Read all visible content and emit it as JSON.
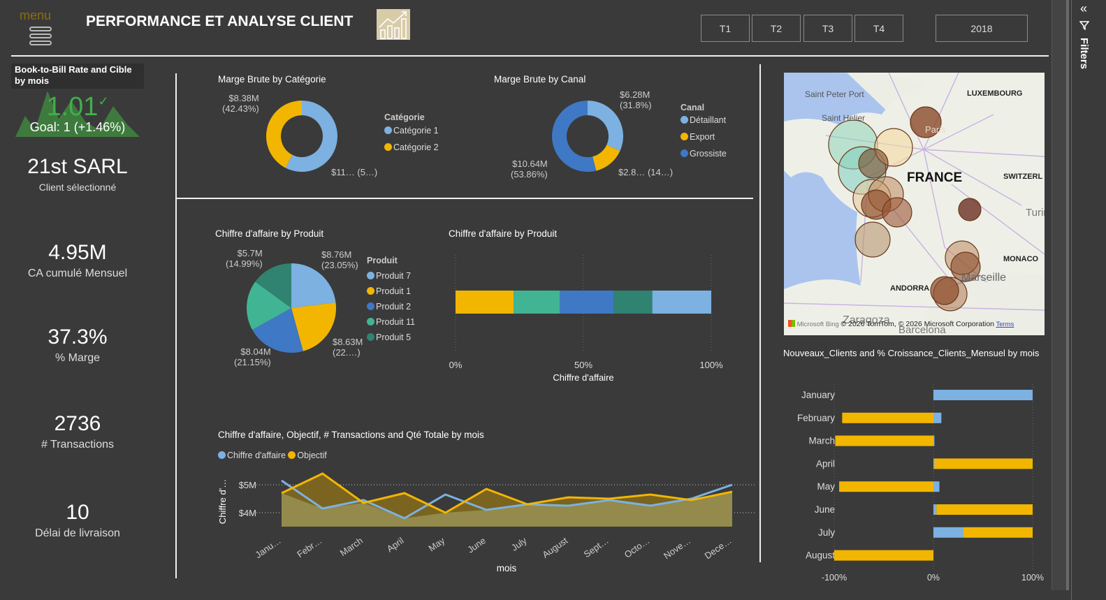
{
  "header": {
    "menu_label": "menu",
    "title": "PERFORMANCE ET ANALYSE CLIENT",
    "quarters": [
      "T1",
      "T2",
      "T3",
      "T4"
    ],
    "year": "2018"
  },
  "filters_pane": {
    "label": "Filters"
  },
  "kpis": {
    "book_to_bill": {
      "title": "Book-to-Bill Rate and Cible by mois",
      "value": "1.01",
      "goal": "Goal: 1 (+1.46%)",
      "color": "#3fb04a"
    },
    "client": {
      "value": "21st SARL",
      "label": "Client sélectionné"
    },
    "ca": {
      "value": "4.95M",
      "label": "CA cumulé Mensuel"
    },
    "marge": {
      "value": "37.3%",
      "label": "% Marge"
    },
    "transactions": {
      "value": "2736",
      "label": "# Transactions"
    },
    "delai": {
      "value": "10",
      "label": "Délai de livraison"
    }
  },
  "colors": {
    "light_blue": "#7cb1e2",
    "yellow": "#f2b600",
    "blue": "#3f78c4",
    "teal": "#41b493",
    "dark_teal": "#2f8370",
    "area": "#938a4c"
  },
  "donut_categorie": {
    "title": "Marge Brute by Catégorie",
    "legend_title": "Catégorie",
    "slices": [
      {
        "name": "Catégorie 1",
        "pct": 57.57,
        "label1": "$11…",
        "label2": "(5…)",
        "color": "#7cb1e2"
      },
      {
        "name": "Catégorie 2",
        "pct": 42.43,
        "label1": "$8.38M",
        "label2": "(42.43%)",
        "color": "#f2b600"
      }
    ]
  },
  "donut_canal": {
    "title": "Marge Brute by Canal",
    "legend_title": "Canal",
    "slices": [
      {
        "name": "Détaillant",
        "pct": 31.8,
        "label1": "$6.28M",
        "label2": "(31.8%)",
        "color": "#7cb1e2"
      },
      {
        "name": "Export",
        "pct": 14.34,
        "label1": "$2.8…",
        "label2": "(14…)",
        "color": "#f2b600"
      },
      {
        "name": "Grossiste",
        "pct": 53.86,
        "label1": "$10.64M",
        "label2": "(53.86%)",
        "color": "#3f78c4"
      }
    ]
  },
  "chart_data": [
    {
      "type": "pie",
      "title": "Chiffre d'affaire by Produit",
      "legend_title": "Produit",
      "slices": [
        {
          "name": "Produit 7",
          "value": 8.76,
          "pct": 23.05,
          "label1": "$8.76M",
          "label2": "(23.05%)",
          "color": "#7cb1e2"
        },
        {
          "name": "Produit 1",
          "value": 8.63,
          "pct": 22.7,
          "label1": "$8.63M",
          "label2": "(22.…)",
          "color": "#f2b600"
        },
        {
          "name": "Produit 2",
          "value": 8.04,
          "pct": 21.15,
          "label1": "$8.04M",
          "label2": "(21.15%)",
          "color": "#3f78c4"
        },
        {
          "name": "Produit 11",
          "value": 6.88,
          "pct": 18.11,
          "label1": "",
          "label2": "",
          "color": "#41b493"
        },
        {
          "name": "Produit 5",
          "value": 5.7,
          "pct": 14.99,
          "label1": "$5.7M",
          "label2": "(14.99%)",
          "color": "#2f8370"
        }
      ]
    },
    {
      "type": "bar",
      "stacked_100": true,
      "title": "Chiffre d'affaire by Produit",
      "xlabel": "Chiffre d'affaire",
      "xticks": [
        "0%",
        "50%",
        "100%"
      ],
      "segments": [
        {
          "name": "Produit 1",
          "pct": 22.7,
          "color": "#f2b600"
        },
        {
          "name": "Produit 11",
          "pct": 18.11,
          "color": "#41b493"
        },
        {
          "name": "Produit 2",
          "pct": 21.15,
          "color": "#3f78c4"
        },
        {
          "name": "Produit 5",
          "pct": 14.99,
          "color": "#2f8370"
        },
        {
          "name": "Produit 7",
          "pct": 23.05,
          "color": "#7cb1e2"
        }
      ]
    },
    {
      "type": "line",
      "title": "Chiffre d'affaire, Objectif, # Transactions and Qté Totale by mois",
      "xlabel": "mois",
      "ylabel": "Chiffre d'…",
      "categories": [
        "Janu…",
        "Febr…",
        "March",
        "April",
        "May",
        "June",
        "July",
        "August",
        "Sept…",
        "Octo…",
        "Nove…",
        "Dece…"
      ],
      "yticks": [
        {
          "v": 4,
          "label": "$4M"
        },
        {
          "v": 5,
          "label": "$5M"
        }
      ],
      "ylim": [
        3.5,
        5.6
      ],
      "grid": true,
      "series": [
        {
          "name": "Chiffre d'affaire",
          "color": "#7cb1e2",
          "values": [
            5.15,
            4.15,
            4.45,
            3.8,
            4.65,
            4.1,
            4.3,
            4.25,
            4.45,
            4.25,
            4.5,
            5.0
          ]
        },
        {
          "name": "Objectif",
          "color": "#f2b600",
          "values": [
            4.7,
            5.4,
            4.35,
            4.7,
            4.0,
            4.85,
            4.3,
            4.55,
            4.5,
            4.65,
            4.45,
            4.75
          ]
        }
      ]
    },
    {
      "type": "bar",
      "orientation": "horizontal",
      "title": "Nouveaux_Clients and % Croissance_Clients_Mensuel by mois",
      "categories": [
        "January",
        "February",
        "March",
        "April",
        "May",
        "June",
        "July",
        "August"
      ],
      "xticks": [
        "-100%",
        "0%",
        "100%"
      ],
      "xlim": [
        -100,
        100
      ],
      "series": [
        {
          "name": "Nouveaux_Clients",
          "color": "#7cb1e2",
          "values": [
            100,
            8,
            1,
            1,
            6,
            3,
            30,
            0
          ]
        },
        {
          "name": "% Croissance_Clients_Mensuel",
          "color": "#f2b600",
          "values": [
            0,
            -92,
            -99,
            99,
            -95,
            97,
            70,
            -100
          ]
        }
      ]
    }
  ],
  "map": {
    "labels": [
      "Saint Peter Port",
      "Saint Helier",
      "Paris",
      "LUXEMBOURG",
      "FRANCE",
      "SWITZERL",
      "Turin",
      "MONACO",
      "Marseille",
      "ANDORRA",
      "Zaragoza",
      "Barcelona"
    ],
    "attribution": "© 2026 TomTom, © 2026 Microsoft Corporation",
    "terms": "Terms",
    "brand": "Microsoft Bing"
  }
}
